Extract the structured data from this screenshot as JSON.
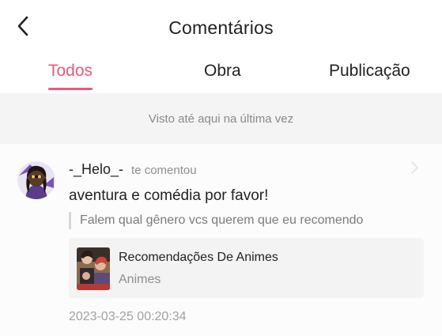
{
  "header": {
    "title": "Comentários",
    "back_icon": "chevron-left-icon"
  },
  "tabs": [
    {
      "label": "Todos",
      "active": true
    },
    {
      "label": "Obra",
      "active": false
    },
    {
      "label": "Publicação",
      "active": false
    }
  ],
  "notice": "Visto até aqui na última vez",
  "comment": {
    "username": "-_Helo_-",
    "action": "te comentou",
    "text": "aventura e comédia por favor!",
    "quoted_text": "Falem qual gênero vcs querem que eu recomendo",
    "work": {
      "title": "Recomendações De Animes",
      "category": "Animes"
    },
    "timestamp": "2023-03-25 00:20:34"
  },
  "colors": {
    "accent": "#f25779",
    "notice_bg": "#f4f4f4",
    "card_bg": "#f3f3f3"
  }
}
